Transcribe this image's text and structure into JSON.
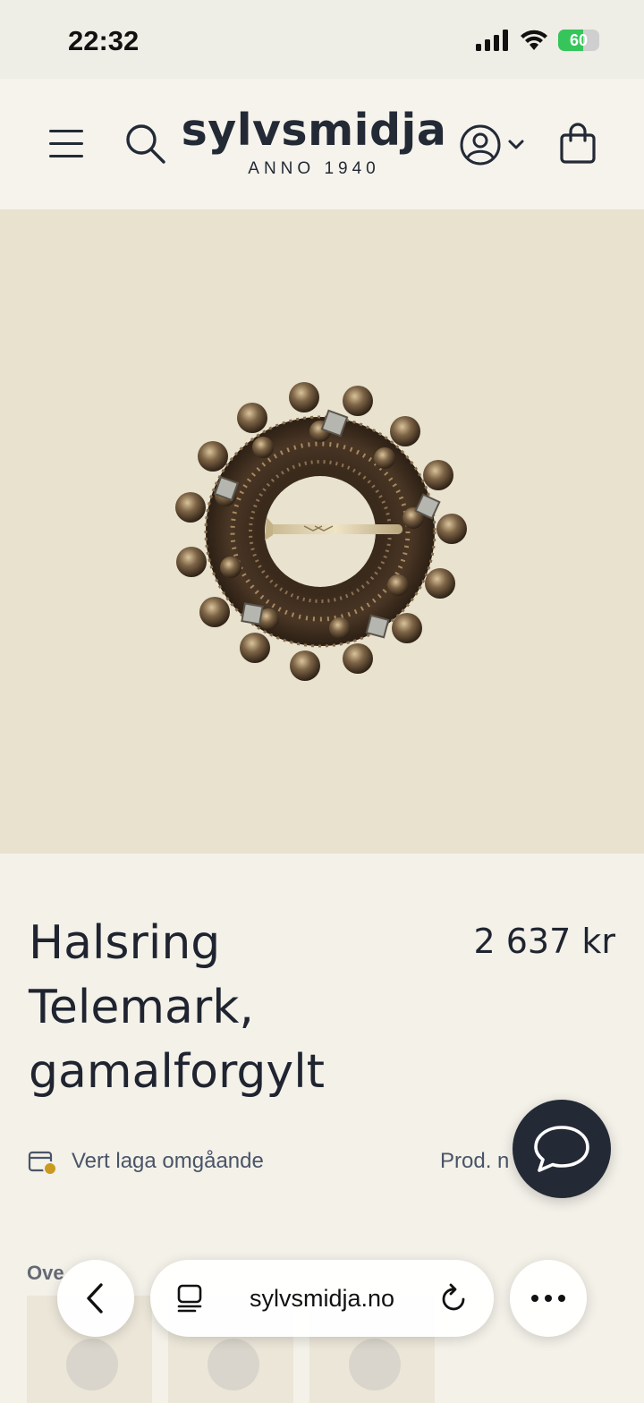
{
  "status_bar": {
    "time": "22:32",
    "battery": "60",
    "battery_level": 0.6
  },
  "header": {
    "logo_name": "sylvsmidja",
    "logo_tagline": "ANNO 1940",
    "icons": [
      "menu-icon",
      "search-icon",
      "account-icon",
      "chevron-down-icon",
      "shopping-bag-icon"
    ]
  },
  "product": {
    "title": "Halsring Telemark, gamalforgylt",
    "price": "2 637 kr",
    "stock_status": "Vert laga omgåande",
    "product_number_label": "Prod. n"
  },
  "tabs": {
    "overview": "Ove"
  },
  "browser": {
    "url": "sylvsmidja.no"
  },
  "colors": {
    "brand_dark": "#232a36",
    "background": "#f3f1e8",
    "hero_bg": "#e8e2cf",
    "accent_gold": "#c99a1e"
  }
}
